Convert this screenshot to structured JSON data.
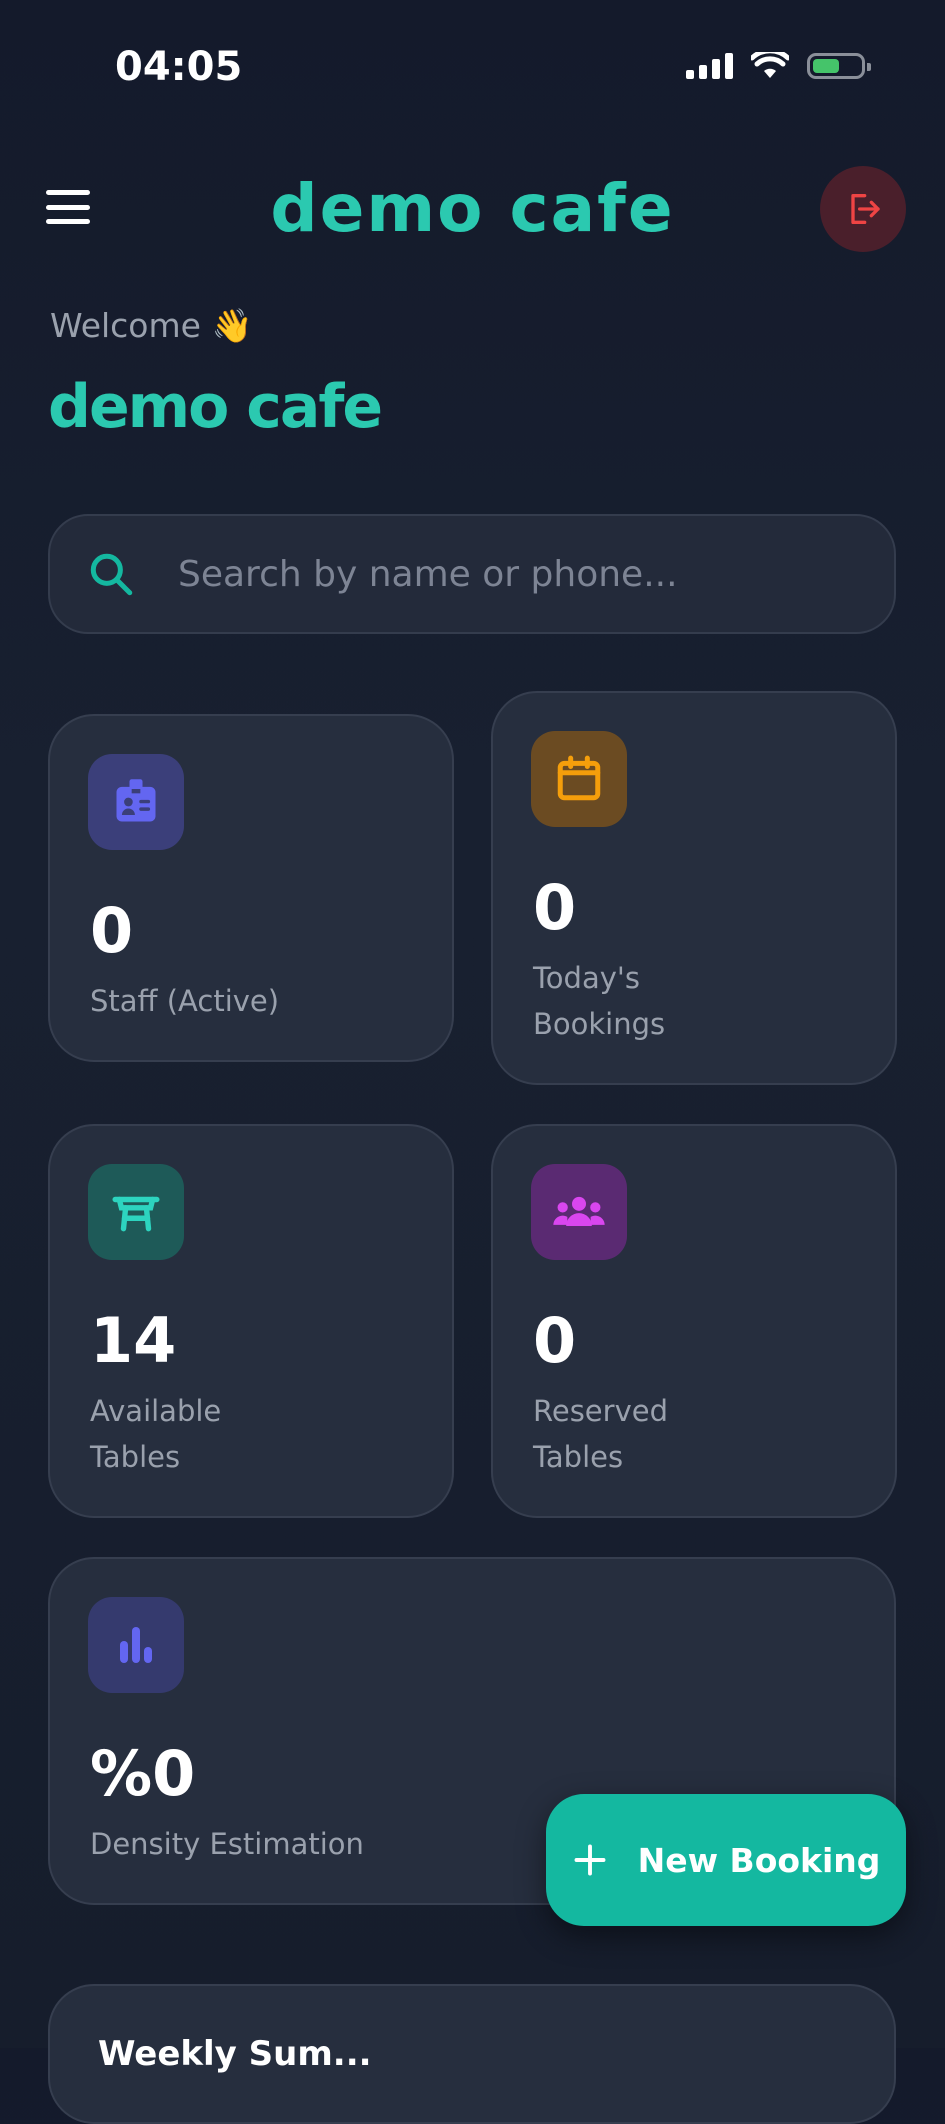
{
  "status_bar": {
    "time": "04:05"
  },
  "header": {
    "title": "demo cafe"
  },
  "welcome": {
    "greeting": "Welcome 👋",
    "name": "demo cafe"
  },
  "search": {
    "placeholder": "Search by name or phone..."
  },
  "stats": [
    {
      "value": "0",
      "label": "Staff (Active)",
      "icon": "id-badge-icon",
      "color": "#6366f1"
    },
    {
      "value": "0",
      "label": "Today's Bookings",
      "icon": "calendar-icon",
      "color": "#f59e0b"
    },
    {
      "value": "14",
      "label": "Available Tables",
      "icon": "table-icon",
      "color": "#2dd4bf"
    },
    {
      "value": "0",
      "label": "Reserved Tables",
      "icon": "people-group-icon",
      "color": "#d946ef"
    },
    {
      "value": "%0",
      "label": "Density Estimation",
      "icon": "bar-chart-icon",
      "color": "#6366f1"
    }
  ],
  "fab": {
    "label": "New Booking"
  },
  "bottom_section": {
    "title": "Weekly Sum..."
  },
  "colors": {
    "accent": "#2bc9b0",
    "background": "#161d2c",
    "card": "#262e3e",
    "danger": "#ef4444"
  }
}
